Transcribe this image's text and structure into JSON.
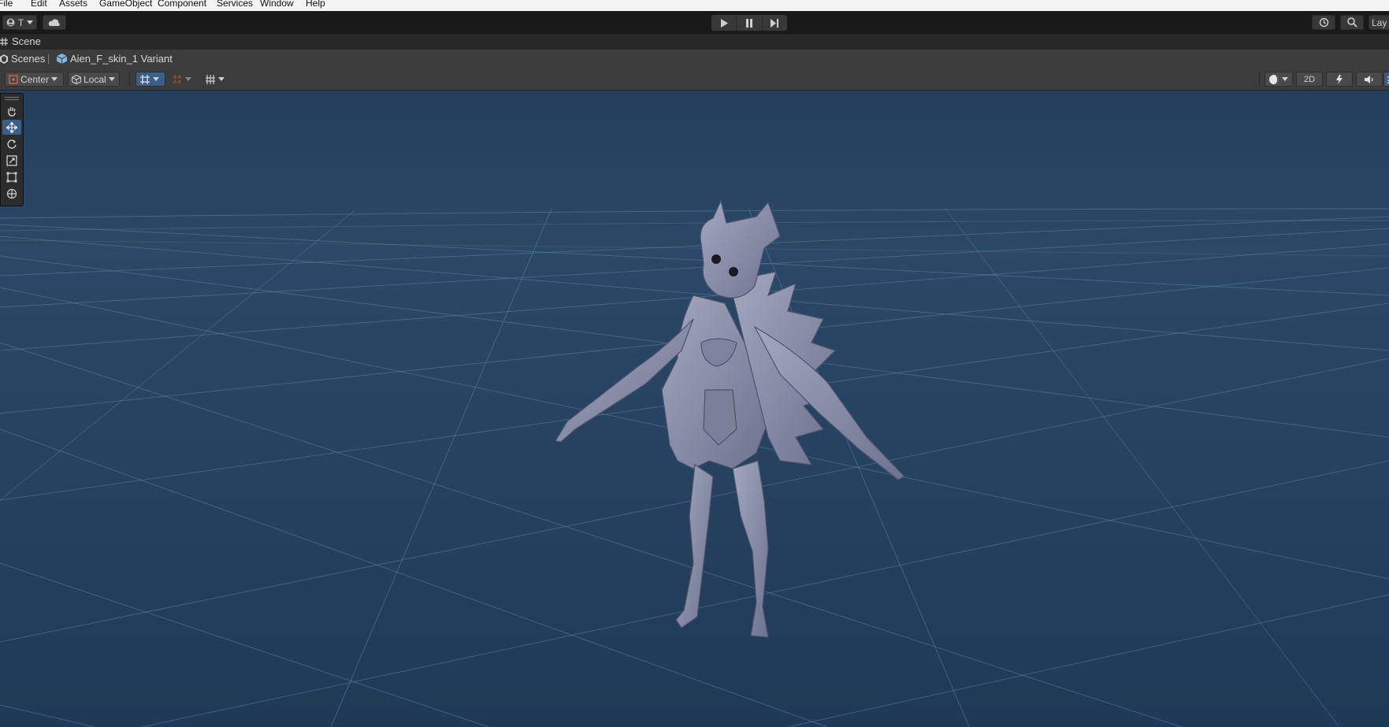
{
  "menu": [
    "File",
    "Edit",
    "Assets",
    "GameObject",
    "Component",
    "Services",
    "Window",
    "Help"
  ],
  "toolbar": {
    "account_label": "T",
    "layers_label": "Lay"
  },
  "scene_tab": {
    "label": "Scene"
  },
  "breadcrumb": {
    "root": "Scenes",
    "prefab": "Aien_F_skin_1 Variant"
  },
  "scene_toolbar": {
    "pivot": "Center",
    "space": "Local",
    "mode_2d": "2D"
  },
  "tools": [
    "hand-tool",
    "move-tool",
    "rotate-tool",
    "scale-tool",
    "rect-tool",
    "transform-tool"
  ],
  "colors": {
    "viewport": "#1f3a55",
    "active_tool": "#3a5f8a",
    "model": "#8a8fa8"
  }
}
